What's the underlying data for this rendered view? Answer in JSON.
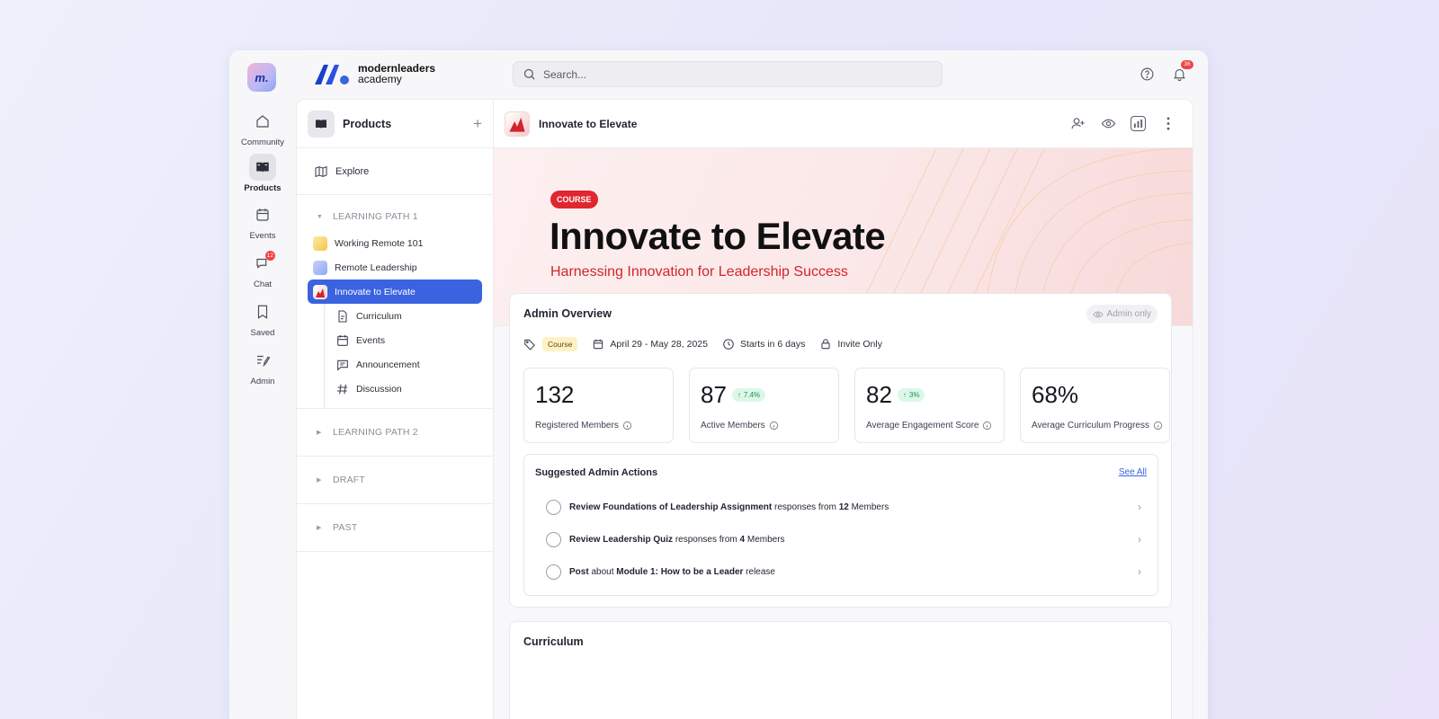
{
  "rail": {
    "logo_text": "m.",
    "items": [
      {
        "label": "Community",
        "icon": "home-icon"
      },
      {
        "label": "Products",
        "icon": "book-icon"
      },
      {
        "label": "Events",
        "icon": "calendar-icon"
      },
      {
        "label": "Chat",
        "icon": "chat-icon",
        "badge": "12"
      },
      {
        "label": "Saved",
        "icon": "bookmark-icon"
      },
      {
        "label": "Admin",
        "icon": "admin-icon"
      }
    ]
  },
  "brand": {
    "line1": "modernleaders",
    "line2": "academy"
  },
  "search": {
    "placeholder": "Search..."
  },
  "topbar": {
    "notification_count": "36"
  },
  "products_panel": {
    "title": "Products",
    "explore_label": "Explore",
    "learning_path_1": {
      "label": "LEARNING PATH 1",
      "items": [
        {
          "label": "Working Remote 101"
        },
        {
          "label": "Remote Leadership"
        },
        {
          "label": "Innovate to Elevate"
        }
      ],
      "sub_items": [
        {
          "label": "Curriculum"
        },
        {
          "label": "Events"
        },
        {
          "label": "Announcement"
        },
        {
          "label": "Discussion"
        }
      ]
    },
    "learning_path_2": {
      "label": "LEARNING PATH 2"
    },
    "draft": {
      "label": "DRAFT"
    },
    "past": {
      "label": "PAST"
    }
  },
  "main": {
    "title": "Innovate to Elevate",
    "hero": {
      "badge": "COURSE",
      "title": "Innovate to Elevate",
      "subtitle": "Harnessing Innovation for Leadership Success"
    },
    "overview": {
      "title": "Admin Overview",
      "admin_only": "Admin only",
      "type_pill": "Course",
      "dates": "April 29 - May 28, 2025",
      "starts": "Starts in 6 days",
      "access": "Invite Only",
      "stats": [
        {
          "value": "132",
          "label": "Registered Members",
          "delta": ""
        },
        {
          "value": "87",
          "label": "Active Members",
          "delta": "7.4%"
        },
        {
          "value": "82",
          "label": "Average Engagement Score",
          "delta": "3%"
        },
        {
          "value": "68%",
          "label": "Average Curriculum Progress",
          "delta": ""
        }
      ]
    },
    "actions": {
      "title": "Suggested Admin Actions",
      "see_all": "See All",
      "rows": [
        {
          "a": "Review Foundations of Leadership Assignment",
          "b": " responses from ",
          "c": "12",
          "d": " Members"
        },
        {
          "a": "Review Leadership Quiz",
          "b": " responses from ",
          "c": "4",
          "d": " Members"
        },
        {
          "a": "Post",
          "b": " about ",
          "c": "Module 1: How to be a Leader",
          "d": " release"
        }
      ]
    },
    "curriculum": {
      "title": "Curriculum"
    }
  },
  "colors": {
    "accent": "#3b63e0",
    "course_red": "#e0262f",
    "positive": "#1d8f52"
  }
}
